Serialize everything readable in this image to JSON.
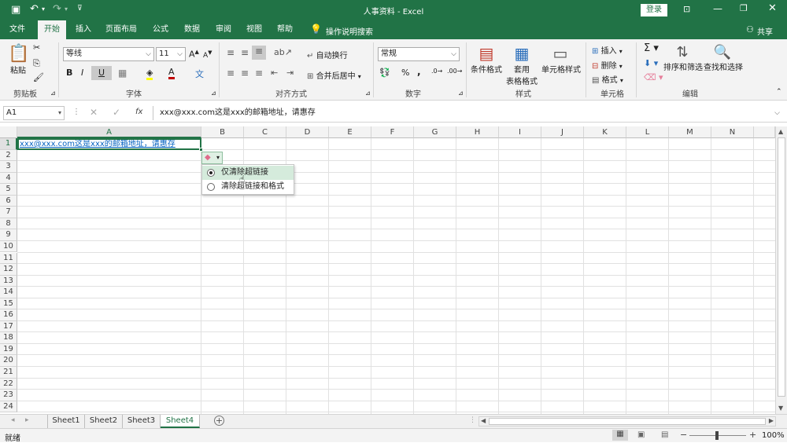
{
  "titlebar": {
    "title": "人事资料 - Excel",
    "login": "登录"
  },
  "tabs": [
    "文件",
    "开始",
    "插入",
    "页面布局",
    "公式",
    "数据",
    "审阅",
    "视图",
    "帮助"
  ],
  "search_hint": "操作说明搜索",
  "share": "共享",
  "ribbon": {
    "clipboard": {
      "paste": "粘贴",
      "label": "剪贴板"
    },
    "font": {
      "name": "等线",
      "size": "11",
      "label": "字体",
      "bold": "B",
      "italic": "I",
      "underline": "U"
    },
    "align": {
      "wrap": "自动换行",
      "merge": "合并后居中",
      "label": "对齐方式"
    },
    "number": {
      "format": "常规",
      "label": "数字"
    },
    "styles": {
      "cond": "条件格式",
      "table1": "套用",
      "table2": "表格格式",
      "cell": "单元格样式",
      "label": "样式"
    },
    "cells": {
      "insert": "插入",
      "delete": "删除",
      "format": "格式",
      "label": "单元格"
    },
    "editing": {
      "sort": "排序和筛选",
      "find": "查找和选择",
      "label": "编辑"
    }
  },
  "formula_bar": {
    "name_box": "A1",
    "content": "xxx@xxx.com这是xxx的邮箱地址，请惠存",
    "fx": "fx"
  },
  "columns": [
    "A",
    "B",
    "C",
    "D",
    "E",
    "F",
    "G",
    "H",
    "I",
    "J",
    "K",
    "L",
    "M",
    "N"
  ],
  "rows": [
    "1",
    "2",
    "3",
    "4",
    "5",
    "6",
    "7",
    "8",
    "9",
    "10",
    "11",
    "12",
    "13",
    "14",
    "15",
    "16",
    "17",
    "18",
    "19",
    "20",
    "21",
    "22",
    "23",
    "24"
  ],
  "cell_a1": "xxx@xxx.com这是xxx的邮箱地址，请惠存",
  "popup": {
    "option1": "仅清除超链接",
    "option2": "清除超链接和格式"
  },
  "sheets": [
    "Sheet1",
    "Sheet2",
    "Sheet3",
    "Sheet4"
  ],
  "active_sheet": "Sheet4",
  "status": {
    "ready": "就绪",
    "zoom": "100%"
  },
  "colors": {
    "accent": "#217346",
    "link": "#0563c1"
  }
}
